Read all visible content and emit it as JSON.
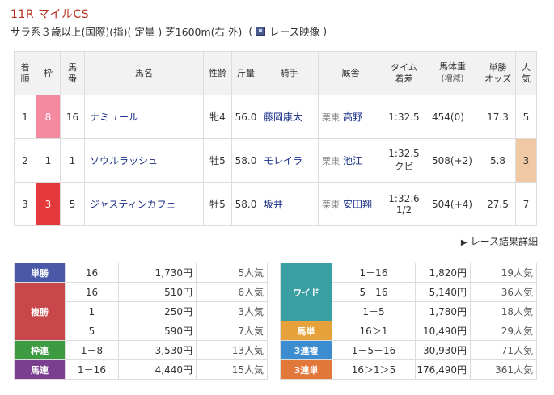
{
  "race": {
    "title": "11R マイルCS",
    "conditions": "サラ系３歳以上(国際)(指)( 定量 ) 芝1600m(右 外)",
    "open_paren": "(",
    "video_label": "レース映像",
    "close_paren": ")"
  },
  "results": {
    "headers": {
      "rank_a": "着",
      "rank_b": "順",
      "frame_a": "枠",
      "num_a": "馬",
      "num_b": "番",
      "horse": "馬名",
      "sexage": "性齢",
      "weight": "斤量",
      "jockey": "騎手",
      "trainer": "厩舎",
      "time_a": "タイム",
      "time_b": "着差",
      "body_a": "馬体重",
      "body_b": "(増減)",
      "odds_a": "単勝",
      "odds_b": "オッズ",
      "pop_a": "人",
      "pop_b": "気"
    },
    "rows": [
      {
        "rank": "1",
        "frame": "8",
        "frame_color": "#f48aa0",
        "frame_text_color": "#ffffff",
        "num": "16",
        "horse": "ナミュール",
        "sexage": "牝4",
        "weight": "56.0",
        "jockey": "藤岡康太",
        "region": "栗東",
        "trainer": "高野",
        "time": "1:32.5",
        "margin": "",
        "body": "454(0)",
        "odds": "17.3",
        "pop": "5",
        "pop_highlight": false
      },
      {
        "rank": "2",
        "frame": "1",
        "frame_color": "#ffffff",
        "frame_text_color": "#333333",
        "num": "1",
        "horse": "ソウルラッシュ",
        "sexage": "牡5",
        "weight": "58.0",
        "jockey": "モレイラ",
        "region": "栗東",
        "trainer": "池江",
        "time": "1:32.5",
        "margin": "クビ",
        "body": "508(+2)",
        "odds": "5.8",
        "pop": "3",
        "pop_highlight": true
      },
      {
        "rank": "3",
        "frame": "3",
        "frame_color": "#e5383b",
        "frame_text_color": "#ffffff",
        "num": "5",
        "horse": "ジャスティンカフェ",
        "sexage": "牡5",
        "weight": "58.0",
        "jockey": "坂井",
        "region": "栗東",
        "trainer": "安田翔",
        "time": "1:32.6",
        "margin": "1/2",
        "body": "504(+4)",
        "odds": "27.5",
        "pop": "7",
        "pop_highlight": false
      }
    ]
  },
  "more_link": "レース結果詳細",
  "payouts_left": [
    {
      "label": "単勝",
      "color": "#4a58a8",
      "entries": [
        {
          "combo": "16",
          "amount": "1,730円",
          "pop": "5人気"
        }
      ]
    },
    {
      "label": "複勝",
      "color": "#c8474b",
      "entries": [
        {
          "combo": "16",
          "amount": "510円",
          "pop": "6人気"
        },
        {
          "combo": "1",
          "amount": "250円",
          "pop": "3人気"
        },
        {
          "combo": "5",
          "amount": "590円",
          "pop": "7人気"
        }
      ]
    },
    {
      "label": "枠連",
      "color": "#3c9a40",
      "entries": [
        {
          "combo": "1－8",
          "amount": "3,530円",
          "pop": "13人気"
        }
      ]
    },
    {
      "label": "馬連",
      "color": "#7b3f8f",
      "entries": [
        {
          "combo": "1－16",
          "amount": "4,440円",
          "pop": "15人気"
        }
      ]
    }
  ],
  "payouts_right": [
    {
      "label": "ワイド",
      "color": "#3a9fa2",
      "entries": [
        {
          "combo": "1－16",
          "amount": "1,820円",
          "pop": "19人気"
        },
        {
          "combo": "5－16",
          "amount": "5,140円",
          "pop": "36人気"
        },
        {
          "combo": "1－5",
          "amount": "1,780円",
          "pop": "18人気"
        }
      ]
    },
    {
      "label": "馬単",
      "color": "#e6a13a",
      "entries": [
        {
          "combo": "16＞1",
          "amount": "10,490円",
          "pop": "29人気"
        }
      ]
    },
    {
      "label": "3連複",
      "color": "#3c8cd0",
      "entries": [
        {
          "combo": "1－5－16",
          "amount": "30,930円",
          "pop": "71人気"
        }
      ]
    },
    {
      "label": "3連単",
      "color": "#e2773a",
      "entries": [
        {
          "combo": "16＞1＞5",
          "amount": "176,490円",
          "pop": "361人気"
        }
      ]
    }
  ]
}
